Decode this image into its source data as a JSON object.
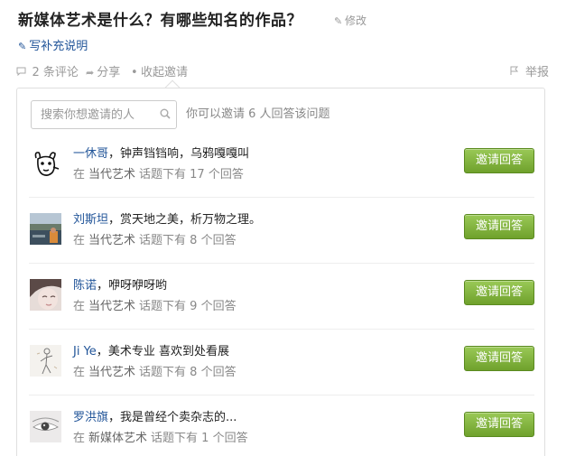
{
  "question": {
    "title": "新媒体艺术是什么？有哪些知名的作品？",
    "edit_label": "修改",
    "supplement_label": "写补充说明"
  },
  "meta": {
    "comments": "2 条评论",
    "share": "分享",
    "collapse_invite": "收起邀请",
    "report": "举报"
  },
  "invite": {
    "search_placeholder": "搜索你想邀请的人",
    "hint": "你可以邀请 6 人回答该问题",
    "button_label": "邀请回答",
    "users": [
      {
        "name": "一休哥",
        "bio": "钟声铛铛响，乌鸦嘎嘎叫",
        "in": "在",
        "topic": "当代艺术",
        "stat": "话题下有 17 个回答",
        "avatar": "cartoon-dog"
      },
      {
        "name": "刘斯坦",
        "bio": "赏天地之美，析万物之理。",
        "in": "在",
        "topic": "当代艺术",
        "stat": "话题下有 8 个回答",
        "avatar": "landscape-photo"
      },
      {
        "name": "陈诺",
        "bio": "咿呀咿呀哟",
        "in": "在",
        "topic": "当代艺术",
        "stat": "话题下有 9 个回答",
        "avatar": "face-photo"
      },
      {
        "name": "Ji Ye",
        "bio": "美术专业 喜欢到处看展",
        "in": "在",
        "topic": "当代艺术",
        "stat": "话题下有 8 个回答",
        "avatar": "sketch-figure"
      },
      {
        "name": "罗洪旗",
        "bio": "我是曾经个卖杂志的...",
        "in": "在",
        "topic": "新媒体艺术",
        "stat": "话题下有 1 个回答",
        "avatar": "eye-photo"
      }
    ]
  }
}
